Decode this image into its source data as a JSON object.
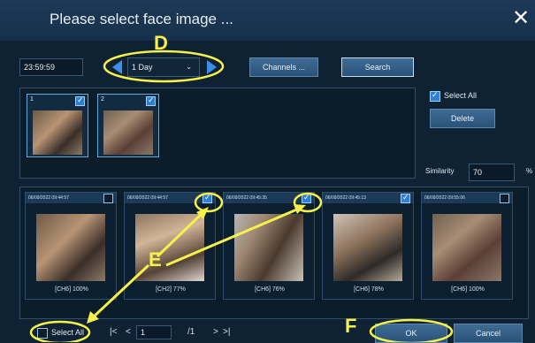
{
  "dialog": {
    "title": "Please select face image ...",
    "close_icon": "✕"
  },
  "toolbar": {
    "time_value": "23:59:59",
    "range_value": "1 Day",
    "channels_label": "Channels ...",
    "search_label": "Search"
  },
  "selected_faces": [
    {
      "index": "1",
      "checked": true
    },
    {
      "index": "2",
      "checked": true
    }
  ],
  "side": {
    "select_all_label": "Select All",
    "delete_label": "Delete",
    "similarity_label": "Similarity",
    "similarity_value": "70",
    "percent": "%"
  },
  "results": [
    {
      "timestamp": "06/09/2022 09:44:57",
      "caption": "[CH6] 100%",
      "checked": false
    },
    {
      "timestamp": "06/09/2022 09:44:57",
      "caption": "[CH2] 77%",
      "checked": true
    },
    {
      "timestamp": "06/09/2022 09:45:35",
      "caption": "[CH6] 76%",
      "checked": true
    },
    {
      "timestamp": "06/09/2022 09:45:13",
      "caption": "[CH6] 78%",
      "checked": true
    },
    {
      "timestamp": "06/09/2022 09:55:06",
      "caption": "[CH6] 100%",
      "checked": false
    }
  ],
  "footer": {
    "select_all_label": "Select All",
    "first": "|<",
    "prev": "<",
    "page_value": "1",
    "total_pages": "/1",
    "next": ">",
    "last": ">|",
    "ok_label": "OK",
    "cancel_label": "Cancel"
  },
  "annotations": {
    "d": "D",
    "e": "E",
    "f": "F"
  }
}
